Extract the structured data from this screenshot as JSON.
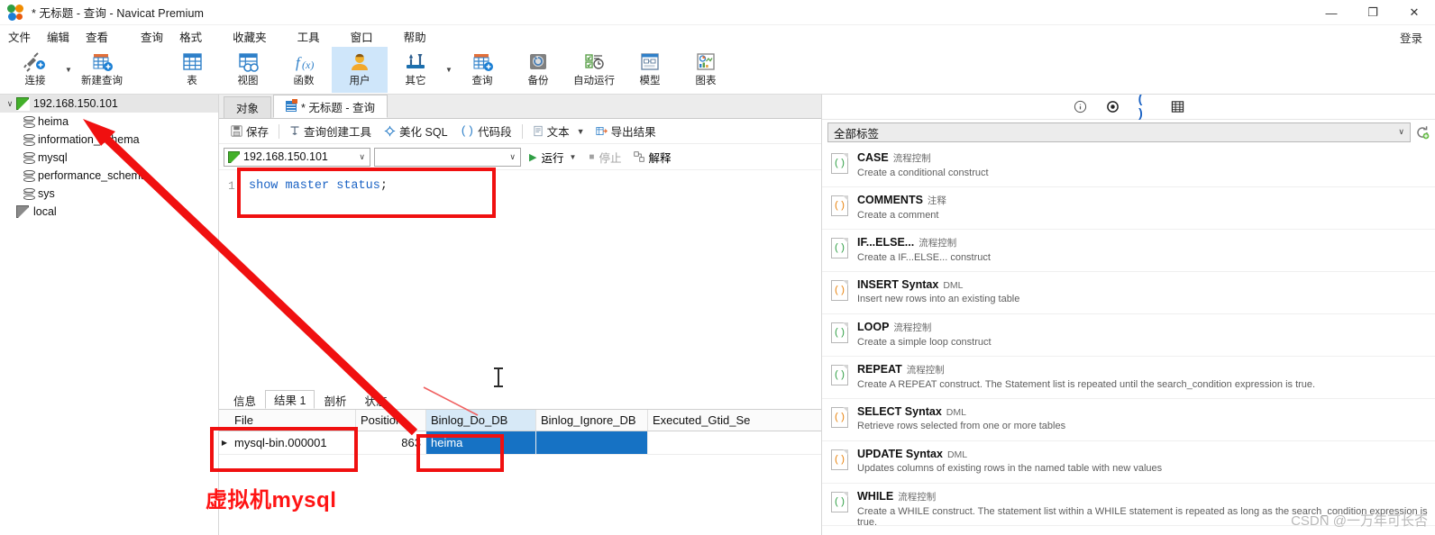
{
  "window": {
    "title": "* 无标题 - 查询 - Navicat Premium",
    "minimize": "—",
    "maximize": "❐",
    "close": "✕"
  },
  "menubar": {
    "items": [
      {
        "label": "文件"
      },
      {
        "label": "编辑"
      },
      {
        "label": "查看"
      },
      {
        "label": "查询"
      },
      {
        "label": "格式"
      },
      {
        "label": "收藏夹"
      },
      {
        "label": "工具"
      },
      {
        "label": "窗口"
      },
      {
        "label": "帮助"
      }
    ],
    "login": "登录"
  },
  "ribbon": {
    "items": [
      {
        "label": "连接",
        "icon": "connect-icon"
      },
      {
        "label": "新建查询",
        "icon": "new-query-icon"
      },
      {
        "label": "表",
        "icon": "table-icon"
      },
      {
        "label": "视图",
        "icon": "view-icon"
      },
      {
        "label": "函数",
        "icon": "function-icon"
      },
      {
        "label": "用户",
        "icon": "user-icon"
      },
      {
        "label": "其它",
        "icon": "other-icon"
      },
      {
        "label": "查询",
        "icon": "query-icon"
      },
      {
        "label": "备份",
        "icon": "backup-icon"
      },
      {
        "label": "自动运行",
        "icon": "automation-icon"
      },
      {
        "label": "模型",
        "icon": "model-icon"
      },
      {
        "label": "图表",
        "icon": "chart-icon"
      }
    ],
    "active": "用户"
  },
  "sidebar": {
    "server": "192.168.150.101",
    "databases": [
      {
        "label": "heima"
      },
      {
        "label": "information_schema"
      },
      {
        "label": "mysql"
      },
      {
        "label": "performance_schema"
      },
      {
        "label": "sys"
      }
    ],
    "local": "local"
  },
  "editor": {
    "tabs": [
      {
        "label": "对象",
        "active": false
      },
      {
        "label": "* 无标题 - 查询",
        "active": true
      }
    ],
    "toolbar": [
      {
        "label": "保存",
        "icon": "save-icon"
      },
      {
        "label": "查询创建工具",
        "icon": "query-builder-icon"
      },
      {
        "label": "美化 SQL",
        "icon": "beautify-icon"
      },
      {
        "label": "代码段",
        "icon": "snippet-icon"
      },
      {
        "label": "文本",
        "icon": "text-icon"
      },
      {
        "label": "导出结果",
        "icon": "export-icon"
      }
    ],
    "connection_value": "192.168.150.101",
    "database_value": "",
    "run_label": "运行",
    "stop_label": "停止",
    "explain_label": "解释",
    "sql_line_number": "1",
    "sql_text": "show master status",
    "sql_terminator": ";"
  },
  "results": {
    "tabs": [
      {
        "label": "信息",
        "active": false
      },
      {
        "label": "结果 1",
        "active": true
      },
      {
        "label": "剖析",
        "active": false
      },
      {
        "label": "状态",
        "active": false
      }
    ],
    "columns": [
      "File",
      "Position",
      "Binlog_Do_DB",
      "Binlog_Ignore_DB",
      "Executed_Gtid_Se"
    ],
    "rows": [
      {
        "File": "mysql-bin.000001",
        "Position": "863",
        "Binlog_Do_DB": "heima",
        "Binlog_Ignore_DB": "",
        "Executed_Gtid_Se": ""
      }
    ],
    "highlighted_column": "Binlog_Do_DB",
    "selected_cell": "heima"
  },
  "snippets_panel": {
    "icons": [
      "info-icon",
      "target-icon",
      "parentheses-icon",
      "grid-icon"
    ],
    "active_icon": "parentheses-icon",
    "filter_value": "全部标签",
    "refresh_icon": "refresh-icon",
    "items": [
      {
        "title": "CASE",
        "category": "流程控制",
        "desc": "Create a conditional construct",
        "color": "#2f9e44"
      },
      {
        "title": "COMMENTS",
        "category": "注释",
        "desc": "Create a comment",
        "color": "#e8820c"
      },
      {
        "title": "IF...ELSE...",
        "category": "流程控制",
        "desc": "Create a IF...ELSE... construct",
        "color": "#2f9e44"
      },
      {
        "title": "INSERT Syntax",
        "category": "DML",
        "desc": "Insert new rows into an existing table",
        "color": "#e8820c"
      },
      {
        "title": "LOOP",
        "category": "流程控制",
        "desc": "Create a simple loop construct",
        "color": "#2f9e44"
      },
      {
        "title": "REPEAT",
        "category": "流程控制",
        "desc": "Create A REPEAT construct. The Statement list is repeated until the search_condition expression is true.",
        "color": "#2f9e44"
      },
      {
        "title": "SELECT Syntax",
        "category": "DML",
        "desc": "Retrieve rows selected from one or more tables",
        "color": "#e8820c"
      },
      {
        "title": "UPDATE Syntax",
        "category": "DML",
        "desc": "Updates columns of existing rows in the named table with new values",
        "color": "#e8820c"
      },
      {
        "title": "WHILE",
        "category": "流程控制",
        "desc": "Create a WHILE construct. The statement list within a WHILE statement is repeated as long as the search_condition expression is true.",
        "color": "#2f9e44"
      }
    ]
  },
  "annotations": {
    "caption": "虚拟机mysql",
    "color": "#ff1414"
  },
  "watermark": "CSDN @一万年可长否"
}
